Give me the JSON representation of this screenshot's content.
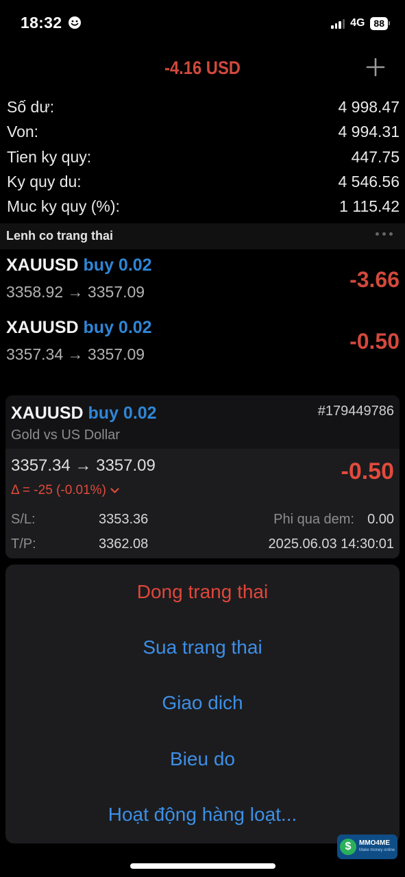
{
  "status_bar": {
    "time": "18:32",
    "network": "4G",
    "battery": "88",
    "icons": [
      "face-smile-icon",
      "signal-icon",
      "battery-icon"
    ]
  },
  "header": {
    "total_profit": "-4.16 USD",
    "add_icon": "plus-icon"
  },
  "account": {
    "rows": [
      {
        "label": "Số dư:",
        "value": "4 998.47"
      },
      {
        "label": "Von:",
        "value": "4 994.31"
      },
      {
        "label": "Tien ky quy:",
        "value": "447.75"
      },
      {
        "label": "Ky quy du:",
        "value": "4 546.56"
      },
      {
        "label": "Muc ky quy (%):",
        "value": "1 115.42"
      }
    ]
  },
  "positions_section": {
    "title": "Lenh co trang thai",
    "more_icon": "more-horizontal-icon"
  },
  "positions": [
    {
      "symbol": "XAUUSD",
      "side": "buy 0.02",
      "prices": "3358.92 → 3357.09",
      "profit": "-3.66"
    },
    {
      "symbol": "XAUUSD",
      "side": "buy 0.02",
      "prices": "3357.34 → 3357.09",
      "profit": "-0.50"
    }
  ],
  "detail_card": {
    "symbol": "XAUUSD",
    "side": "buy 0.02",
    "ticket": "#179449786",
    "description": "Gold vs US Dollar",
    "prices": "3357.34 → 3357.09",
    "profit": "-0.50",
    "delta": "Δ = -25 (-0.01%)",
    "sl_label": "S/L:",
    "sl_value": "3353.36",
    "tp_label": "T/P:",
    "tp_value": "3362.08",
    "swap_label": "Phi qua dem:",
    "swap_value": "0.00",
    "open_time": "2025.06.03 14:30:01"
  },
  "action_sheet": {
    "close": "Dong trang thai",
    "modify": "Sua trang thai",
    "trade": "Giao dich",
    "chart": "Bieu do",
    "bulk": "Hoạt động hàng loạt..."
  },
  "watermark": {
    "name": "MMO4ME",
    "tagline": "Make money online"
  },
  "colors": {
    "loss_red": "#d2493c",
    "accent_blue": "#3d8fe6",
    "background": "#000000",
    "sheet": "#1c1c1e"
  }
}
